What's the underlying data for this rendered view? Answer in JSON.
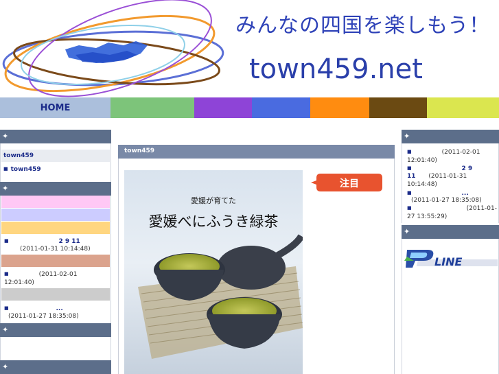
{
  "header": {
    "tagline": "みんなの四国を楽しもう！",
    "domain": "town459.net"
  },
  "nav": {
    "home_label": "HOME",
    "segment_colors": [
      "#7dc47a",
      "#8e44d7",
      "#4a6be0",
      "#ff8c10",
      "#6b4a12",
      "#dbe64f"
    ]
  },
  "left": {
    "box1_label": "town459",
    "box1_item": "town459",
    "band_colors": [
      "#ffc8f5",
      "#ccccff",
      "#ffd680",
      "#dba38d",
      "#cccccc"
    ],
    "post1_title": "2 9 11",
    "post1_date": "(2011-01-31 10:14:48)",
    "post2_date": "(2011-02-01 12:01:40)",
    "post3_title": "...",
    "post3_date": "(2011-01-27 18:35:08)"
  },
  "center": {
    "title": "town459",
    "banner_caption_small": "愛媛が育てた",
    "banner_caption_large": "愛媛べにふうき緑茶",
    "callout_text": "注目"
  },
  "right": {
    "post1_date": "(2011-02-01 12:01:40)",
    "post2_title": "2 9",
    "post2_num": "11",
    "post2_date": "(2011-01-31 10:14:48)",
    "post3_title": "...",
    "post3_date": "(2011-01-27 18:35:08)",
    "post4_date": "(2011-01-27 13:55:29)",
    "logo_text": "LINE"
  },
  "icons": {
    "section_icon": "diamond-star-icon",
    "bullet_icon": "square-bullet-icon"
  }
}
